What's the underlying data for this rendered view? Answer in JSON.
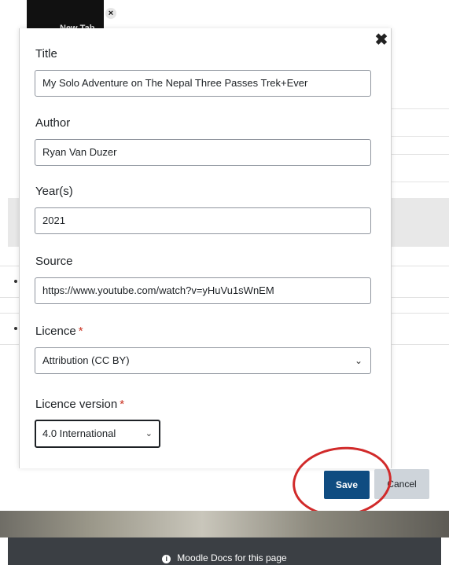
{
  "background": {
    "thumbnail_text": "New Tab"
  },
  "dialog": {
    "close_symbol": "✖",
    "fields": {
      "title_label": "Title",
      "title_value": "My Solo Adventure on The Nepal Three Passes Trek+Ever",
      "author_label": "Author",
      "author_value": "Ryan Van Duzer",
      "years_label": "Year(s)",
      "years_value": "2021",
      "source_label": "Source",
      "source_value": "https://www.youtube.com/watch?v=yHuVu1sWnEM",
      "licence_label": "Licence",
      "licence_value": "Attribution (CC BY)",
      "licence_version_label": "Licence version",
      "licence_version_value": "4.0 International"
    },
    "required_marker": "*",
    "chevron": "⌄"
  },
  "buttons": {
    "save": "Save",
    "cancel": "Cancel"
  },
  "annotation": {
    "circle_color": "#d12a2a"
  },
  "footer": {
    "info_icon": "i",
    "docs_link": "Moodle Docs for this page"
  },
  "colors": {
    "primary": "#0f4c81",
    "required": "#ca3120",
    "footer_bg": "#3b3f44"
  }
}
